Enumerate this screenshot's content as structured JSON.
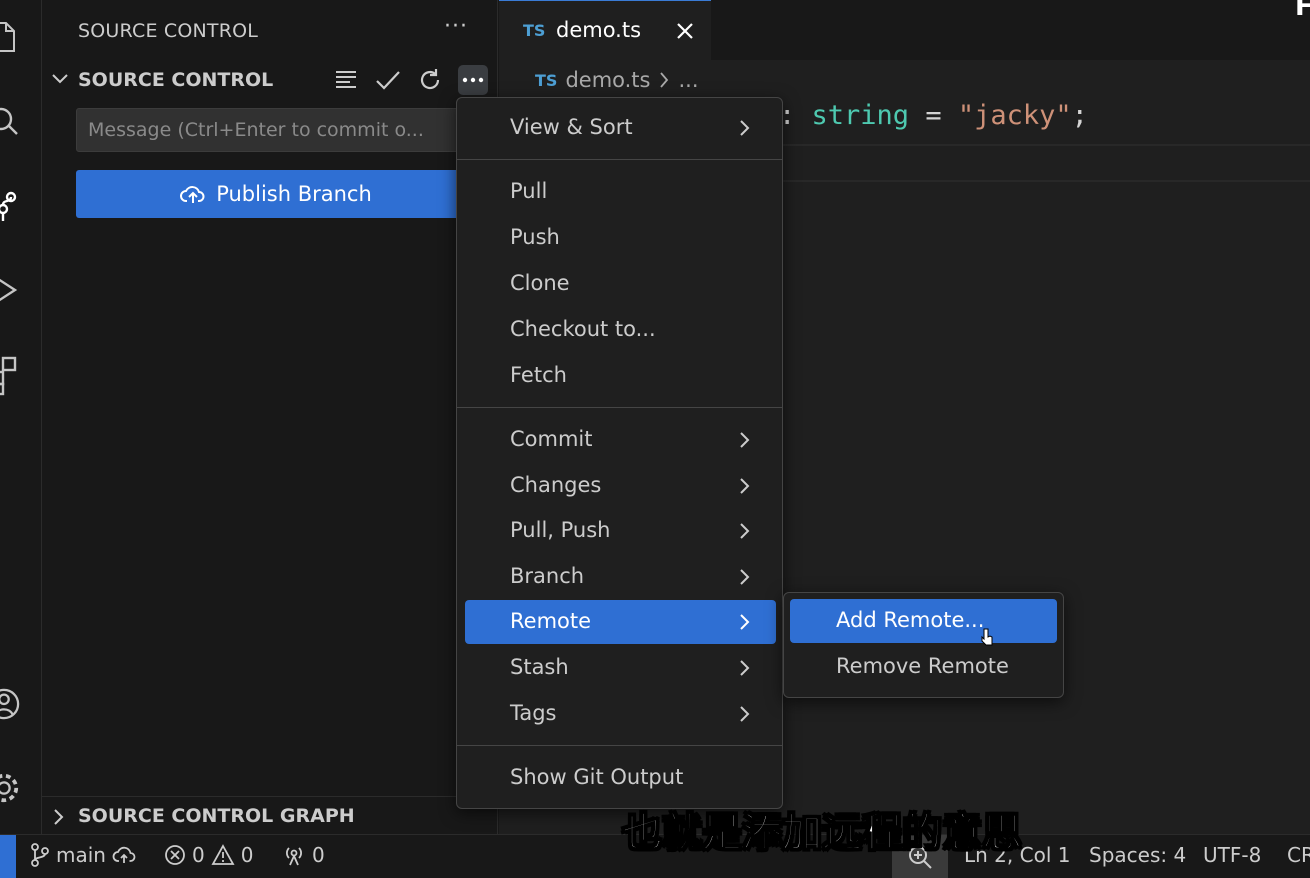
{
  "sidebar": {
    "title": "SOURCE CONTROL",
    "title_more": "···",
    "section_label": "SOURCE CONTROL",
    "message_placeholder": "Message (Ctrl+Enter to commit o...",
    "publish_label": "Publish Branch",
    "graph_label": "SOURCE CONTROL GRAPH"
  },
  "editor": {
    "tab_badge": "TS",
    "tab_name": "demo.ts",
    "breadcrumb_badge": "TS",
    "breadcrumb_file": "demo.ts",
    "breadcrumb_more": "...",
    "code": {
      "colon": ": ",
      "type": "string",
      "eq": " = ",
      "str": "\"jacky\"",
      "semi": ";"
    },
    "corner_glyph": "F"
  },
  "menu": {
    "items": [
      {
        "label": "View & Sort",
        "submenu": true
      },
      {
        "label": "Pull",
        "submenu": false
      },
      {
        "label": "Push",
        "submenu": false
      },
      {
        "label": "Clone",
        "submenu": false
      },
      {
        "label": "Checkout to...",
        "submenu": false
      },
      {
        "label": "Fetch",
        "submenu": false
      },
      {
        "label": "Commit",
        "submenu": true
      },
      {
        "label": "Changes",
        "submenu": true
      },
      {
        "label": "Pull, Push",
        "submenu": true
      },
      {
        "label": "Branch",
        "submenu": true
      },
      {
        "label": "Remote",
        "submenu": true,
        "active": true
      },
      {
        "label": "Stash",
        "submenu": true
      },
      {
        "label": "Tags",
        "submenu": true
      },
      {
        "label": "Show Git Output",
        "submenu": false
      }
    ]
  },
  "submenu": {
    "items": [
      {
        "label": "Add Remote...",
        "active": true
      },
      {
        "label": "Remove Remote"
      }
    ]
  },
  "status": {
    "branch": "main",
    "errors": "0",
    "warnings": "0",
    "ports": "0",
    "position": "Ln 2, Col 1",
    "spaces": "Spaces: 4",
    "encoding": "UTF-8",
    "eol": "CR"
  },
  "subtitle": "也就是添加远程的意思",
  "colors": {
    "accent": "#2f6fd3",
    "background": "#181818",
    "editor_bg": "#1f1f1f",
    "ts_badge": "#4d9fd4",
    "type": "#4ec9b0",
    "string": "#ce9178"
  }
}
